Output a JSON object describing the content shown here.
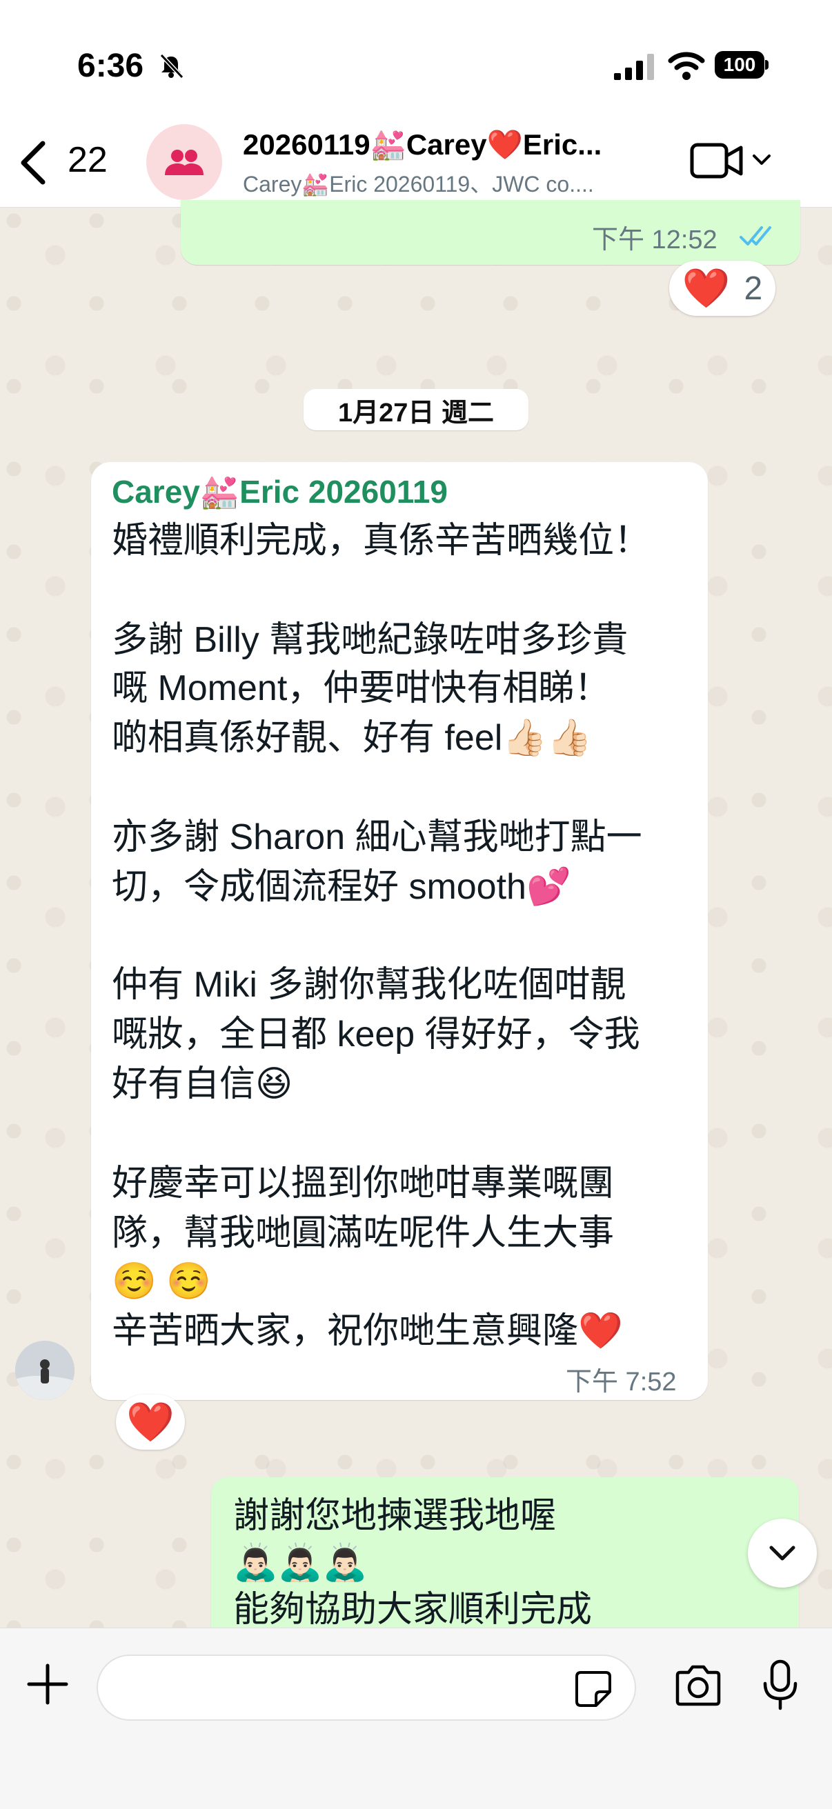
{
  "status_bar": {
    "time": "6:36",
    "battery": "100"
  },
  "header": {
    "back_count": "22",
    "title": "20260119💒Carey❤️Eric...",
    "subtitle": "Carey💒Eric 20260119、JWC co...."
  },
  "messages": {
    "prev_out_time": "下午 12:52",
    "prev_out_reaction": "❤️",
    "prev_out_reaction_count": "2",
    "date_separator": "1月27日 週二",
    "incoming": {
      "sender": "Carey💒Eric 20260119",
      "lines": [
        "婚禮順利完成，真係辛苦晒幾位！",
        "",
        "多謝 Billy 幫我哋紀錄咗咁多珍貴",
        "嘅 Moment，仲要咁快有相睇！",
        "啲相真係好靚、好有 feel👍🏻👍🏻",
        "",
        "亦多謝 Sharon 細心幫我哋打點一",
        "切，令成個流程好 smooth💕",
        "",
        "仲有 Miki 多謝你幫我化咗個咁靚",
        "嘅妝，全日都 keep 得好好，令我",
        "好有自信😆",
        "",
        "好慶幸可以搵到你哋咁專業嘅團",
        "隊，幫我哋圓滿咗呢件人生大事",
        "☺️ ☺️",
        "辛苦晒大家，祝你哋生意興隆❤️"
      ],
      "time": "下午 7:52",
      "reaction": "❤️"
    },
    "outgoing": {
      "lines": [
        "謝謝您地揀選我地喔",
        "🙇🏻‍♂️🙇🏻‍♂️🙇🏻‍♂️",
        "能夠協助大家順利完成"
      ]
    }
  },
  "input": {
    "placeholder": ""
  },
  "colors": {
    "outgoing_bubble": "#d9fdd3",
    "sender_name": "#1f8f5f",
    "read_ticks": "#53bdeb",
    "group_avatar_bg": "#fbdcde",
    "group_avatar_icon": "#e0245e"
  },
  "icons": [
    "mute-icon",
    "signal-icon",
    "wifi-icon",
    "battery-icon",
    "back-chevron-icon",
    "group-icon",
    "video-call-icon",
    "chevron-down-icon",
    "double-check-icon",
    "plus-icon",
    "sticker-icon",
    "camera-icon",
    "mic-icon"
  ]
}
